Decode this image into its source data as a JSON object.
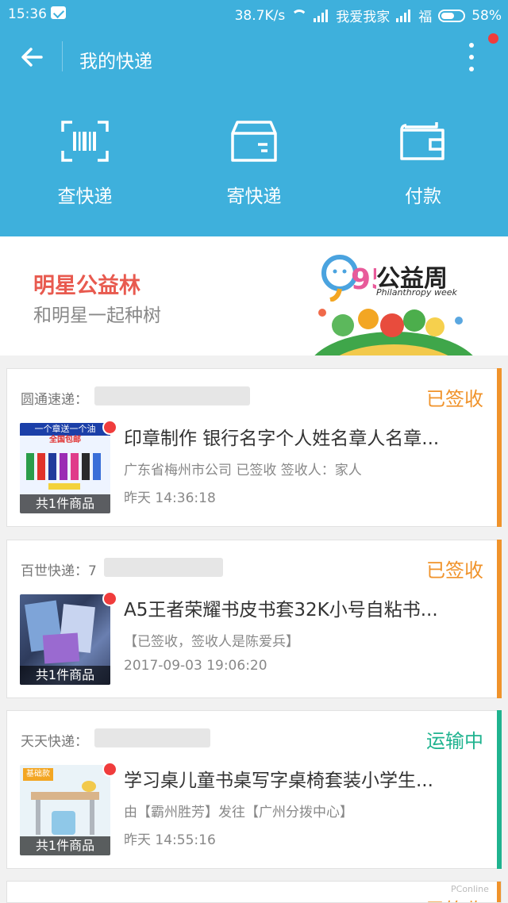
{
  "status_bar": {
    "time": "15:36",
    "speed": "38.7K/s",
    "carrier1": "我爱我家",
    "carrier2": "福",
    "battery": "58%"
  },
  "app_bar": {
    "title": "我的快递",
    "back_icon": "arrow-left-icon",
    "more_icon": "more-vertical-icon"
  },
  "actions": [
    {
      "label": "查快递",
      "icon": "barcode-scan-icon"
    },
    {
      "label": "寄快递",
      "icon": "parcel-box-icon"
    },
    {
      "label": "付款",
      "icon": "wallet-icon"
    }
  ],
  "banner": {
    "title": "明星公益林",
    "subtitle": "和明星一起种树",
    "logo_text": "公益周",
    "logo_en": "Philanthropy week",
    "logo_number": "95"
  },
  "colors": {
    "header": "#3eb0dc",
    "signed": "#f0932b",
    "transit": "#1fb38f",
    "badge_red": "#f03c3c"
  },
  "parcels": [
    {
      "courier": "圆通速递：",
      "status": "已签收",
      "status_type": "signed",
      "title": "印章制作 银行名字个人姓名章人名章...",
      "detail": "广东省梅州市公司 已签收 签收人：家人",
      "time": "昨天 14:36:18",
      "thumb_caption": "共1件商品",
      "thumb_text": "一个章送一个油",
      "thumb_text2": "全国包邮"
    },
    {
      "courier": "百世快递：7",
      "status": "已签收",
      "status_type": "signed",
      "title": "A5王者荣耀书皮书套32K小号自粘书...",
      "detail": "【已签收，签收人是陈爱兵】",
      "time": "2017-09-03 19:06:20",
      "thumb_caption": "共1件商品"
    },
    {
      "courier": "天天快递：",
      "status": "运输中",
      "status_type": "transit",
      "title": "学习桌儿童书桌写字桌椅套装小学生...",
      "detail": "由【霸州胜芳】发往【广州分拨中心】",
      "time": "昨天 14:55:16",
      "thumb_caption": "共1件商品",
      "thumb_text": "基础款"
    }
  ],
  "next_card_status": "已签收",
  "watermark": "PConline"
}
